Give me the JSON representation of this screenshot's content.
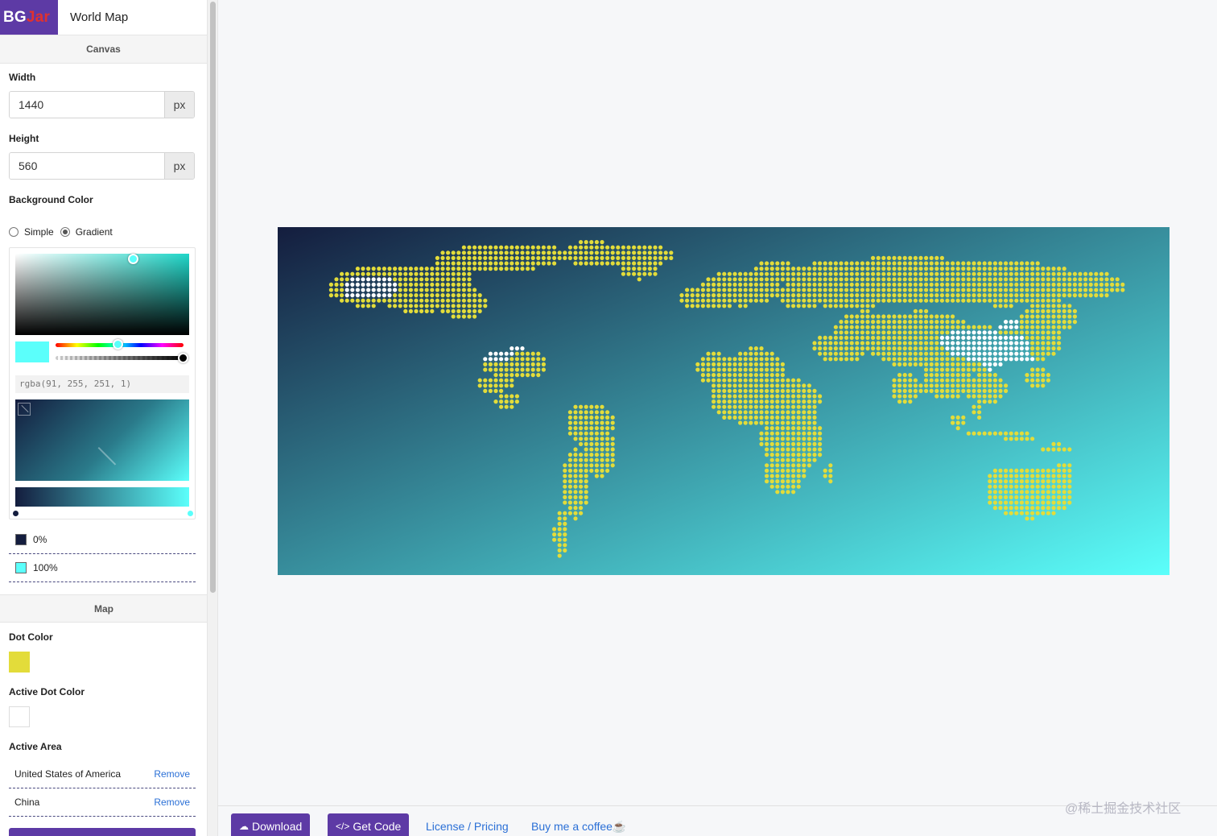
{
  "app": {
    "logo_left": "BG",
    "logo_right": "Jar",
    "title": "World Map"
  },
  "canvas_section": {
    "header": "Canvas",
    "width_label": "Width",
    "width_value": "1440",
    "width_unit": "px",
    "height_label": "Height",
    "height_value": "560",
    "height_unit": "px",
    "bg_label": "Background Color",
    "radio_simple": "Simple",
    "radio_gradient": "Gradient",
    "selected_mode": "Gradient",
    "rgba": "rgba(91, 255, 251, 1)",
    "gradient_start": "#141d3e",
    "gradient_end": "#5bfffb",
    "stops": [
      {
        "label": "0%",
        "color": "#141d3e"
      },
      {
        "label": "100%",
        "color": "#5bfffb"
      }
    ]
  },
  "map_section": {
    "header": "Map",
    "dot_color_label": "Dot Color",
    "dot_color": "#e3dc3a",
    "active_dot_color_label": "Active Dot Color",
    "active_dot_color": "#ffffff",
    "active_area_label": "Active Area",
    "active_areas": [
      {
        "name": "United States of America",
        "action": "Remove"
      },
      {
        "name": "China",
        "action": "Remove"
      }
    ]
  },
  "toolbar": {
    "download_label": "Download",
    "get_code_label": "Get Code",
    "license_label": "License / Pricing",
    "coffee_label": "Buy me a coffee☕"
  },
  "watermark": "@稀土掘金技术社区",
  "icons": {
    "download": "cloud-download-icon",
    "code": "code-icon"
  }
}
